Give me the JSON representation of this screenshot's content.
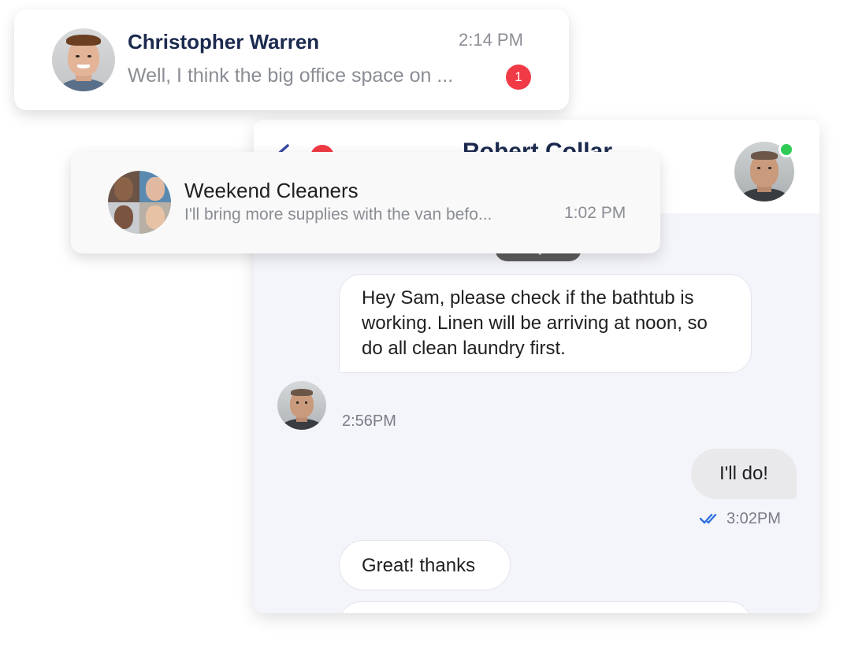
{
  "conversation_cards": {
    "christopher": {
      "name": "Christopher Warren",
      "time": "2:14 PM",
      "preview": "Well, I think the big office space on ...",
      "unread_count": "1"
    },
    "weekend_cleaners": {
      "name": "Weekend Cleaners",
      "preview": "I'll bring more supplies with the van befo...",
      "time": "1:02 PM"
    }
  },
  "chat": {
    "title": "Robert Collar",
    "date_divider": "May 7",
    "messages": [
      {
        "direction": "incoming",
        "text": "Hey Sam, please check if the bathtub is working. Linen will be arriving at noon, so do all clean laundry first.",
        "time": "2:56PM"
      },
      {
        "direction": "outgoing",
        "text": "I'll do!",
        "time": "3:02PM",
        "status": "read"
      },
      {
        "direction": "incoming",
        "text": "Great! thanks"
      }
    ]
  },
  "icons": {
    "back": "chevron-left-icon",
    "read_status": "double-check-icon",
    "presence": "online-status-dot"
  },
  "colors": {
    "badge_red": "#f03a45",
    "online_green": "#2ecc55",
    "title_navy": "#1b2a4e",
    "read_tick_blue": "#2f6fe0",
    "chat_background": "#f4f5fa"
  }
}
